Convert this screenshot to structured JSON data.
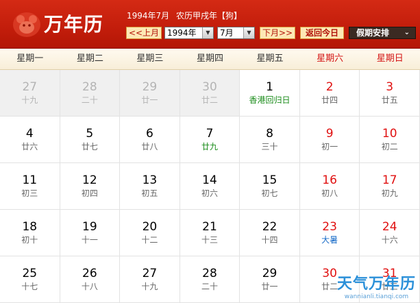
{
  "header": {
    "logo_text": "万年历",
    "date_text": "1994年7月",
    "lunar_text": "农历甲戌年【狗】",
    "prev_month": "<<上月",
    "year_value": "1994年",
    "month_value": "7月",
    "next_month": "下月>>",
    "today": "返回今日",
    "holiday": "假期安排"
  },
  "weekdays": [
    "星期一",
    "星期二",
    "星期三",
    "星期四",
    "星期五",
    "星期六",
    "星期日"
  ],
  "days": [
    {
      "day": "27",
      "sub": "十九",
      "other": true
    },
    {
      "day": "28",
      "sub": "二十",
      "other": true
    },
    {
      "day": "29",
      "sub": "廿一",
      "other": true
    },
    {
      "day": "30",
      "sub": "廿二",
      "other": true
    },
    {
      "day": "1",
      "sub": "香港回归日",
      "other": false,
      "subColor": "green"
    },
    {
      "day": "2",
      "sub": "廿四",
      "other": false
    },
    {
      "day": "3",
      "sub": "廿五",
      "other": false
    },
    {
      "day": "4",
      "sub": "廿六",
      "other": false
    },
    {
      "day": "5",
      "sub": "廿七",
      "other": false
    },
    {
      "day": "6",
      "sub": "廿八",
      "other": false
    },
    {
      "day": "7",
      "sub": "廿九",
      "other": false,
      "subColor": "green"
    },
    {
      "day": "8",
      "sub": "三十",
      "other": false
    },
    {
      "day": "9",
      "sub": "初一",
      "other": false
    },
    {
      "day": "10",
      "sub": "初二",
      "other": false
    },
    {
      "day": "11",
      "sub": "初三",
      "other": false
    },
    {
      "day": "12",
      "sub": "初四",
      "other": false
    },
    {
      "day": "13",
      "sub": "初五",
      "other": false
    },
    {
      "day": "14",
      "sub": "初六",
      "other": false
    },
    {
      "day": "15",
      "sub": "初七",
      "other": false
    },
    {
      "day": "16",
      "sub": "初八",
      "other": false
    },
    {
      "day": "17",
      "sub": "初九",
      "other": false
    },
    {
      "day": "18",
      "sub": "初十",
      "other": false
    },
    {
      "day": "19",
      "sub": "十一",
      "other": false
    },
    {
      "day": "20",
      "sub": "十二",
      "other": false
    },
    {
      "day": "21",
      "sub": "十三",
      "other": false
    },
    {
      "day": "22",
      "sub": "十四",
      "other": false
    },
    {
      "day": "23",
      "sub": "大暑",
      "other": false,
      "subColor": "blue"
    },
    {
      "day": "24",
      "sub": "十六",
      "other": false
    },
    {
      "day": "25",
      "sub": "十七",
      "other": false
    },
    {
      "day": "26",
      "sub": "十八",
      "other": false
    },
    {
      "day": "27",
      "sub": "十九",
      "other": false
    },
    {
      "day": "28",
      "sub": "二十",
      "other": false
    },
    {
      "day": "29",
      "sub": "廿一",
      "other": false
    },
    {
      "day": "30",
      "sub": "廿二",
      "other": false
    },
    {
      "day": "31",
      "sub": "廿三",
      "other": false
    }
  ],
  "watermark": {
    "main": "天气万年历",
    "sub": "wannianli.tianqi.com"
  }
}
